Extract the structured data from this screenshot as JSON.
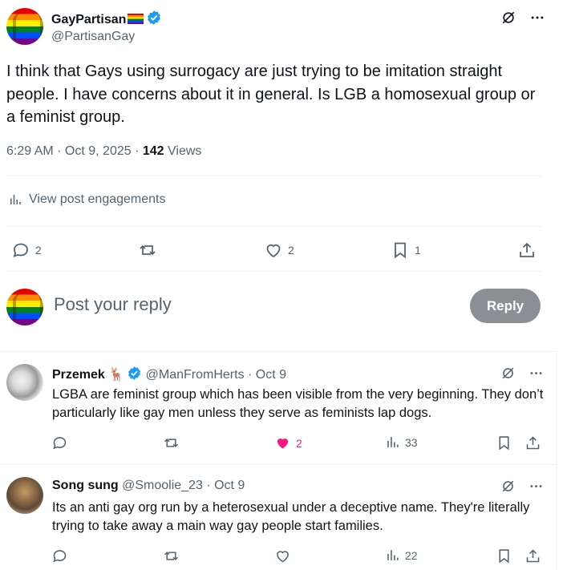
{
  "post": {
    "display_name": "GayPartisan",
    "handle": "@PartisanGay",
    "text": "I think that Gays using surrogacy are just trying to be imitation straight people. I have concerns about it in general. Is LGB a homosexual group or a feminist group.",
    "time": "6:29 AM · Oct 9, 2025 · ",
    "views_count": "142",
    "views_label": " Views",
    "engagements_label": "View post engagements",
    "stats": {
      "replies": "2",
      "likes": "2",
      "bookmarks": "1"
    }
  },
  "reply_box": {
    "placeholder": "Post your reply",
    "button_label": "Reply"
  },
  "replies": [
    {
      "display_name": "Przemek",
      "emoji": "🦌",
      "handle": "@ManFromHerts",
      "date": "· Oct 9",
      "text": "LGBA are feminist group which has been visible from the very beginning. They don’t particularly like gay men unless they serve as feminists lap dogs.",
      "likes": "2",
      "views": "33"
    },
    {
      "display_name": "Song sung",
      "handle": "@Smoolie_23",
      "date": "· Oct 9",
      "text": "Its an anti gay org run by a heterosexual under a deceptive name. They're literally trying to take away a main way gay people start families.",
      "views": "22"
    }
  ],
  "colors": {
    "accent": "#1d9bf0",
    "like": "#f91880",
    "muted": "#536471",
    "reply_button": "#8a8f93"
  }
}
